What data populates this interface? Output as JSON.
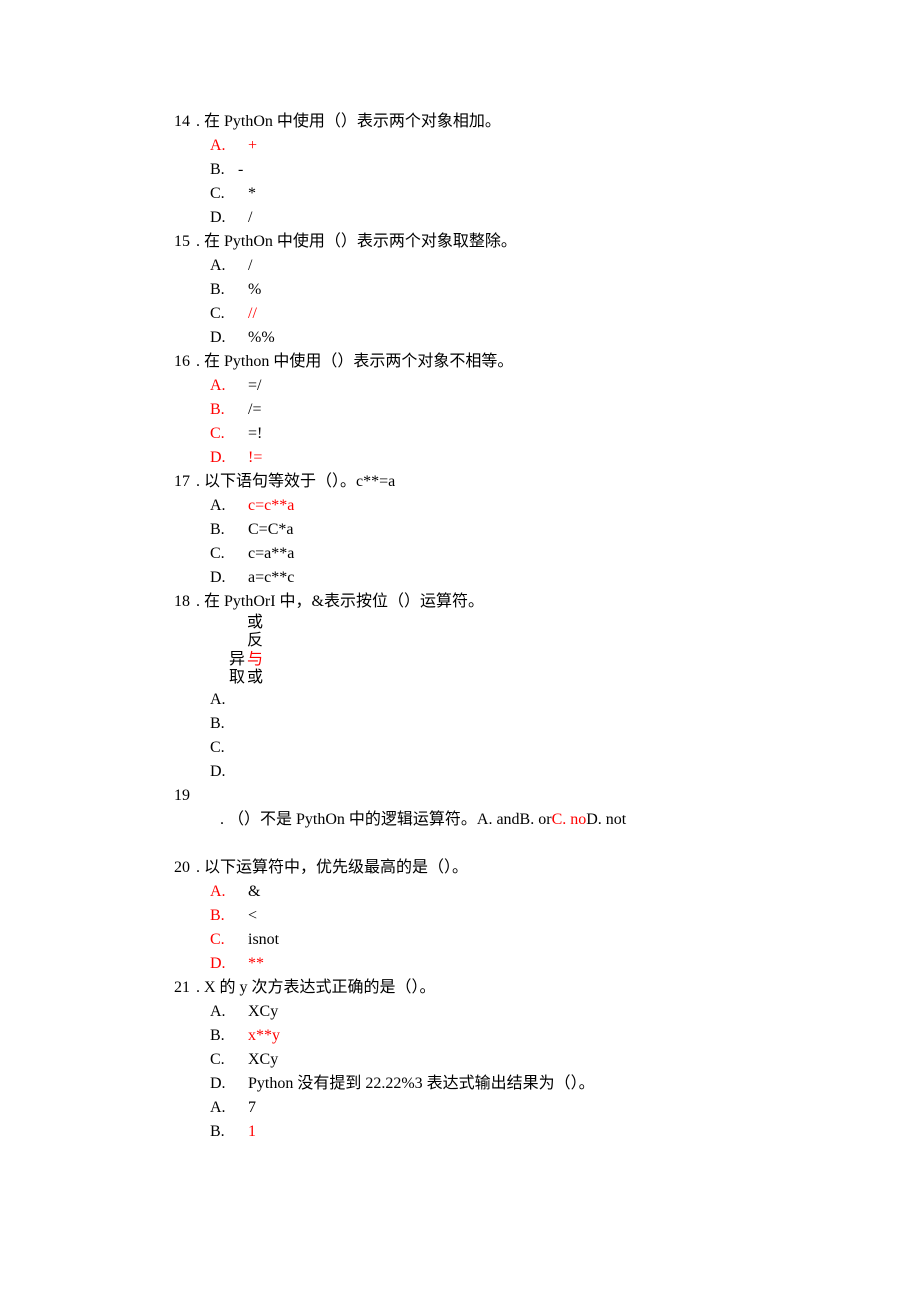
{
  "q14": {
    "num": "14",
    "text": ". 在 PythOn 中使用（）表示两个对象相加。",
    "opts": [
      {
        "label": "A.",
        "text": "+",
        "labelRed": true,
        "textRed": true
      },
      {
        "label": "B.",
        "text": "-",
        "labelRed": false,
        "textRed": false,
        "tight": true
      },
      {
        "label": "C.",
        "text": "*",
        "labelRed": false,
        "textRed": false
      },
      {
        "label": "D.",
        "text": "/",
        "labelRed": false,
        "textRed": false
      }
    ]
  },
  "q15": {
    "num": "15",
    "text": ". 在 PythOn 中使用（）表示两个对象取整除。",
    "opts": [
      {
        "label": "A.",
        "text": "/",
        "labelRed": false,
        "textRed": false
      },
      {
        "label": "B.",
        "text": "%",
        "labelRed": false,
        "textRed": false
      },
      {
        "label": "C.",
        "text": "//",
        "labelRed": false,
        "textRed": true
      },
      {
        "label": "D.",
        "text": "%%",
        "labelRed": false,
        "textRed": false
      }
    ]
  },
  "q16": {
    "num": "16",
    "text": ". 在 Python 中使用（）表示两个对象不相等。",
    "opts": [
      {
        "label": "A.",
        "text": "=/",
        "labelRed": true,
        "textRed": false
      },
      {
        "label": "B.",
        "text": "/=",
        "labelRed": true,
        "textRed": false
      },
      {
        "label": "C.",
        "text": "=!",
        "labelRed": true,
        "textRed": false
      },
      {
        "label": "D.",
        "text": "!=",
        "labelRed": true,
        "textRed": true
      }
    ]
  },
  "q17": {
    "num": "17",
    "text": ". 以下语句等效于（）。c**=a",
    "opts": [
      {
        "label": "A.",
        "text": "c=c**a",
        "labelRed": false,
        "textRed": true
      },
      {
        "label": "B.",
        "text": "C=C*a",
        "labelRed": false,
        "textRed": false
      },
      {
        "label": "C.",
        "text": "c=a**a",
        "labelRed": false,
        "textRed": false
      },
      {
        "label": "D.",
        "text": "a=c**c",
        "labelRed": false,
        "textRed": false
      }
    ]
  },
  "q18": {
    "num": "18",
    "text": ". 在 PythOrI 中，&表示按位（）运算符。",
    "stack": {
      "row1": {
        "c1": "",
        "c2": "或"
      },
      "row2": {
        "c1": "",
        "c2": "反"
      },
      "row3": {
        "c1": "异",
        "c2": "与",
        "c2Red": true
      },
      "row4": {
        "c1": "取",
        "c2": "或"
      }
    },
    "labels": [
      "A.",
      "B.",
      "C.",
      "D."
    ]
  },
  "q19": {
    "num": "19",
    "text_a": ". （）不是 PythOn 中的逻辑运算符。A. andB. or",
    "text_b": "C. no",
    "text_c": "D. not"
  },
  "q20": {
    "num": "20",
    "text": ". 以下运算符中，优先级最高的是（）。",
    "opts": [
      {
        "label": "A.",
        "text": "&",
        "labelRed": true,
        "textRed": false
      },
      {
        "label": "B.",
        "text": "<",
        "labelRed": true,
        "textRed": false
      },
      {
        "label": "C.",
        "text": "isnot",
        "labelRed": true,
        "textRed": false
      },
      {
        "label": "D.",
        "text": "**",
        "labelRed": true,
        "textRed": true
      }
    ]
  },
  "q21": {
    "num": "21",
    "text": ". X 的 y 次方表达式正确的是（）。",
    "opts": [
      {
        "label": "A.",
        "text": "XCy",
        "labelRed": false,
        "textRed": false
      },
      {
        "label": "B.",
        "text": "x**y",
        "labelRed": false,
        "textRed": true
      },
      {
        "label": "C.",
        "text": "XCy",
        "labelRed": false,
        "textRed": false
      },
      {
        "label": "D.",
        "text": "Python 没有提到 22.22%3 表达式输出结果为（）。",
        "labelRed": false,
        "textRed": false
      },
      {
        "label": "A.",
        "text": "7",
        "labelRed": false,
        "textRed": false
      },
      {
        "label": "B.",
        "text": "1",
        "labelRed": false,
        "textRed": true
      }
    ]
  }
}
